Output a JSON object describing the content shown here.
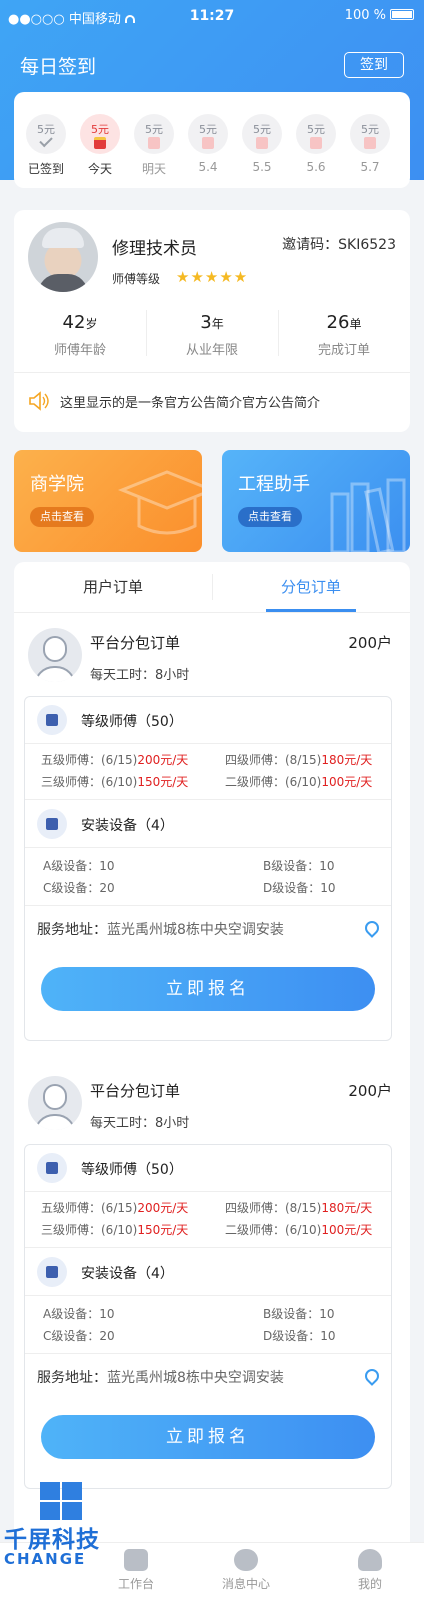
{
  "status_bar": {
    "carrier": "●●○○○ 中国移动",
    "time": "11:27",
    "battery": "100 %"
  },
  "header": {
    "title": "每日签到",
    "sign_button": "签到"
  },
  "checkin": {
    "days": [
      {
        "amount": "5元",
        "label": "已签到",
        "state": "done"
      },
      {
        "amount": "5元",
        "label": "今天",
        "state": "today"
      },
      {
        "amount": "5元",
        "label": "明天",
        "state": "future"
      },
      {
        "amount": "5元",
        "label": "5.4",
        "state": "future"
      },
      {
        "amount": "5元",
        "label": "5.5",
        "state": "future"
      },
      {
        "amount": "5元",
        "label": "5.6",
        "state": "future"
      },
      {
        "amount": "5元",
        "label": "5.7",
        "state": "future"
      }
    ]
  },
  "profile": {
    "name": "修理技术员",
    "invite_code": "邀请码：SKI6523",
    "level_label": "师傅等级",
    "stars": 5,
    "stats": [
      {
        "value": "42",
        "unit": "岁",
        "label": "师傅年龄"
      },
      {
        "value": "3",
        "unit": "年",
        "label": "从业年限"
      },
      {
        "value": "26",
        "unit": "单",
        "label": "完成订单"
      }
    ],
    "notice": "这里显示的是一条官方公告简介官方公告简介"
  },
  "promos": [
    {
      "title": "商学院",
      "button": "点击查看",
      "color": "#fb9a3a"
    },
    {
      "title": "工程助手",
      "button": "点击查看",
      "color": "#3d9af2"
    }
  ],
  "orders": {
    "tabs": [
      "用户订单",
      "分包订单"
    ],
    "active_tab": 1,
    "cards": [
      {
        "title": "平台分包订单",
        "count": "200户",
        "hours": "每天工时：8小时",
        "masters_title": "等级师傅（50）",
        "masters": [
          {
            "label": "五级师傅：(6/15)",
            "price": "200元/天"
          },
          {
            "label": "四级师傅：(8/15)",
            "price": "180元/天"
          },
          {
            "label": "三级师傅：(6/10)",
            "price": "150元/天"
          },
          {
            "label": "二级师傅：(6/10)",
            "price": "100元/天"
          }
        ],
        "equip_title": "安装设备（4）",
        "equip": [
          "A级设备：10",
          "B级设备：10",
          "C级设备：20",
          "D级设备：10"
        ],
        "addr_label": "服务地址：",
        "addr": "蓝光禹州城8栋中央空调安装",
        "apply": "立即报名"
      },
      {
        "title": "平台分包订单",
        "count": "200户",
        "hours": "每天工时：8小时",
        "masters_title": "等级师傅（50）",
        "masters": [
          {
            "label": "五级师傅：(6/15)",
            "price": "200元/天"
          },
          {
            "label": "四级师傅：(8/15)",
            "price": "180元/天"
          },
          {
            "label": "三级师傅：(6/10)",
            "price": "150元/天"
          },
          {
            "label": "二级师傅：(6/10)",
            "price": "100元/天"
          }
        ],
        "equip_title": "安装设备（4）",
        "equip": [
          "A级设备：10",
          "B级设备：10",
          "C级设备：20",
          "D级设备：10"
        ],
        "addr_label": "服务地址：",
        "addr": "蓝光禹州城8栋中央空调安装",
        "apply": "立即报名"
      }
    ]
  },
  "tabbar": [
    {
      "label": "工作台",
      "icon": "chart-icon"
    },
    {
      "label": "消息中心",
      "icon": "chat-icon"
    },
    {
      "label": "我的",
      "icon": "user-icon"
    }
  ],
  "watermark": {
    "line1": "千屏科技",
    "line2": "CHANGE"
  }
}
